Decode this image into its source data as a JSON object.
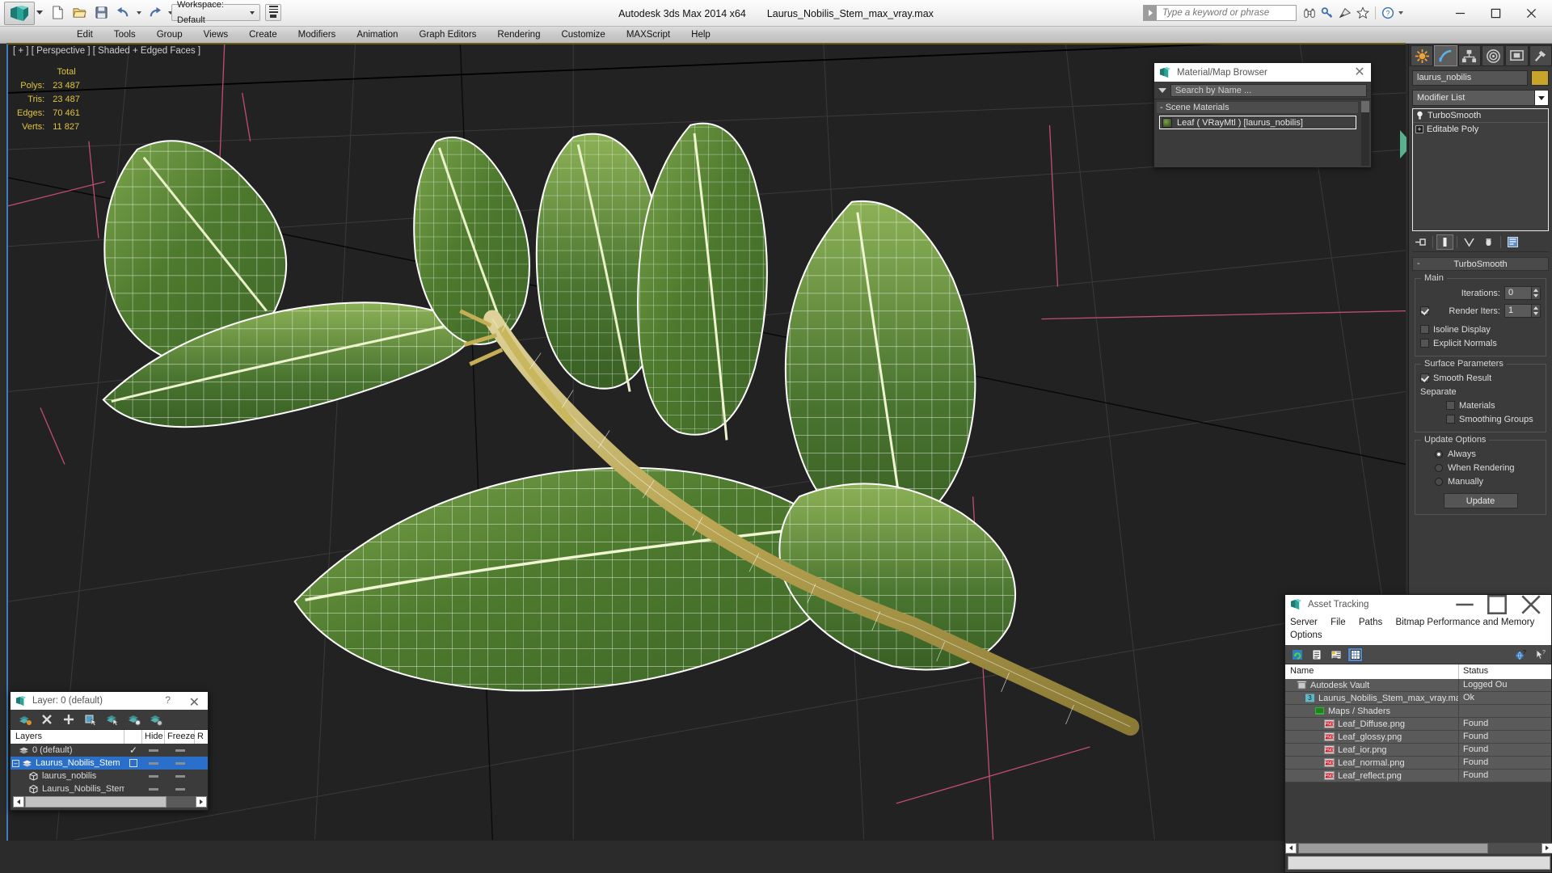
{
  "app": {
    "title_product": "Autodesk 3ds Max  2014 x64",
    "title_file": "Laurus_Nobilis_Stem_max_vray.max",
    "logo_icon": "3dsmax-logo-icon"
  },
  "quick_access": {
    "items": [
      {
        "name": "new-file-button",
        "icon": "new-file-icon"
      },
      {
        "name": "open-file-button",
        "icon": "open-folder-icon"
      },
      {
        "name": "save-file-button",
        "icon": "save-disk-icon"
      },
      {
        "name": "undo-button",
        "icon": "undo-arrow-icon"
      },
      {
        "name": "undo-dropdown",
        "icon": "chevron-down-icon"
      },
      {
        "name": "redo-button",
        "icon": "redo-arrow-icon"
      },
      {
        "name": "redo-dropdown",
        "icon": "chevron-down-icon"
      },
      {
        "name": "set-project-folder-button",
        "icon": "project-folder-icon"
      }
    ],
    "workspace_label": "Workspace: Default"
  },
  "search": {
    "placeholder": "Type a keyword or phrase",
    "value": ""
  },
  "title_icons": [
    {
      "name": "info-center-button",
      "icon": "binoculars-icon"
    },
    {
      "name": "subscription-center-button",
      "icon": "key-icon"
    },
    {
      "name": "communication-center-button",
      "icon": "satellite-dish-icon"
    },
    {
      "name": "favorites-button",
      "icon": "star-icon"
    },
    {
      "name": "help-button",
      "icon": "question-circle-icon"
    }
  ],
  "window_buttons": [
    {
      "name": "minimize-window-button",
      "icon": "minimize-icon"
    },
    {
      "name": "maximize-window-button",
      "icon": "maximize-icon"
    },
    {
      "name": "close-window-button",
      "icon": "close-icon"
    }
  ],
  "menubar": {
    "items": [
      "Edit",
      "Tools",
      "Group",
      "Views",
      "Create",
      "Modifiers",
      "Animation",
      "Graph Editors",
      "Rendering",
      "Customize",
      "MAXScript",
      "Help"
    ]
  },
  "viewport": {
    "label": "[ + ] [ Perspective ] [ Shaded + Edged Faces ]",
    "stats": {
      "header": "Total",
      "rows": [
        {
          "label": "Polys:",
          "value": "23 487"
        },
        {
          "label": "Tris:",
          "value": "23 487"
        },
        {
          "label": "Edges:",
          "value": "70 461"
        },
        {
          "label": "Verts:",
          "value": "11 827"
        }
      ]
    }
  },
  "material_browser": {
    "title": "Material/Map Browser",
    "close_label": "✕",
    "search_placeholder": "Search by Name ...",
    "group_label": "- Scene Materials",
    "items": [
      {
        "label": "Leaf  ( VRayMtl )  [laurus_nobilis]",
        "selected": true
      }
    ]
  },
  "command_panel": {
    "tabs": [
      {
        "name": "tab-create",
        "icon": "create-star-icon",
        "active": false
      },
      {
        "name": "tab-modify",
        "icon": "modify-curve-icon",
        "active": true
      },
      {
        "name": "tab-hierarchy",
        "icon": "hierarchy-icon",
        "active": false
      },
      {
        "name": "tab-motion",
        "icon": "motion-wheel-icon",
        "active": false
      },
      {
        "name": "tab-display",
        "icon": "display-monitor-icon",
        "active": false
      },
      {
        "name": "tab-utilities",
        "icon": "utilities-hammer-icon",
        "active": false
      }
    ],
    "object_name": "laurus_nobilis",
    "object_color": "#c8a42a",
    "modifier_list_label": "Modifier List",
    "stack": [
      {
        "label": "TurboSmooth",
        "icon": "lightbulb-icon",
        "selected": true
      },
      {
        "label": "Editable Poly",
        "icon": "expand-plus-icon",
        "selected": false
      }
    ],
    "stack_buttons": [
      {
        "name": "pin-stack-button",
        "icon": "pin-stack-icon"
      },
      {
        "name": "show-end-result-button",
        "icon": "show-end-result-icon"
      },
      {
        "name": "make-unique-button",
        "icon": "make-unique-icon"
      },
      {
        "name": "remove-modifier-button",
        "icon": "trash-can-icon"
      },
      {
        "name": "configure-modifier-sets-button",
        "icon": "configure-sets-icon"
      }
    ],
    "turbosmooth": {
      "rollup_title": "TurboSmooth",
      "main_group": "Main",
      "iterations_label": "Iterations:",
      "iterations_value": "0",
      "render_iters_label": "Render Iters:",
      "render_iters_value": "1",
      "render_iters_checked": true,
      "isoline_display_label": "Isoline Display",
      "isoline_display_checked": false,
      "explicit_normals_label": "Explicit Normals",
      "explicit_normals_checked": false,
      "surface_group": "Surface Parameters",
      "smooth_result_label": "Smooth Result",
      "smooth_result_checked": true,
      "separate_label": "Separate",
      "separate_materials_label": "Materials",
      "separate_materials_checked": false,
      "separate_smoothing_label": "Smoothing Groups",
      "separate_smoothing_checked": false,
      "update_group": "Update Options",
      "update_always_label": "Always",
      "update_when_rendering_label": "When Rendering",
      "update_manually_label": "Manually",
      "update_selected": "Always",
      "update_button_label": "Update"
    }
  },
  "asset_tracking": {
    "title": "Asset Tracking",
    "menu": [
      "Server",
      "File",
      "Paths",
      "Bitmap Performance and Memory",
      "Options"
    ],
    "toolbar": [
      {
        "name": "refresh-button",
        "icon": "refresh-icon",
        "active": false
      },
      {
        "name": "list-view-button",
        "icon": "list-icon",
        "active": false
      },
      {
        "name": "detail-view-button",
        "icon": "detail-icon",
        "active": false
      },
      {
        "name": "grid-view-button",
        "icon": "grid-icon",
        "active": true
      },
      {
        "name": "help-globe-button",
        "icon": "help-globe-icon",
        "active": false
      },
      {
        "name": "help-cursor-button",
        "icon": "help-cursor-icon",
        "active": false
      }
    ],
    "columns": [
      "Name",
      "Status"
    ],
    "rows": [
      {
        "name": "Autodesk Vault",
        "status": "Logged Ou",
        "indent": 0,
        "icon": "vault-icon"
      },
      {
        "name": "Laurus_Nobilis_Stem_max_vray.max",
        "status": "Ok",
        "indent": 1,
        "icon": "max-file-icon"
      },
      {
        "name": "Maps / Shaders",
        "status": "",
        "indent": 2,
        "icon": "maps-shaders-icon"
      },
      {
        "name": "Leaf_Diffuse.png",
        "status": "Found",
        "indent": 3,
        "icon": "png-icon"
      },
      {
        "name": "Leaf_glossy.png",
        "status": "Found",
        "indent": 3,
        "icon": "png-icon"
      },
      {
        "name": "Leaf_ior.png",
        "status": "Found",
        "indent": 3,
        "icon": "png-icon"
      },
      {
        "name": "Leaf_normal.png",
        "status": "Found",
        "indent": 3,
        "icon": "png-icon"
      },
      {
        "name": "Leaf_reflect.png",
        "status": "Found",
        "indent": 3,
        "icon": "png-icon"
      }
    ],
    "window_buttons": [
      {
        "name": "minimize-asset-button",
        "icon": "minimize-icon"
      },
      {
        "name": "maximize-asset-button",
        "icon": "maximize-icon"
      },
      {
        "name": "close-asset-button",
        "icon": "close-icon"
      }
    ]
  },
  "layer_dialog": {
    "title": "Layer: 0 (default)",
    "help_label": "?",
    "close_label": "✕",
    "toolbar": [
      {
        "name": "create-new-layer-button",
        "icon": "new-layer-icon"
      },
      {
        "name": "delete-layer-button",
        "icon": "delete-layer-icon"
      },
      {
        "name": "add-selection-to-layer-button",
        "icon": "add-layer-icon"
      },
      {
        "name": "select-objects-in-layer-button",
        "icon": "select-in-layer-icon"
      },
      {
        "name": "select-highlighted-layers-button",
        "icon": "select-highlighted-icon"
      },
      {
        "name": "highlight-selected-objects-layer-button",
        "icon": "highlight-selected-icon"
      },
      {
        "name": "layer-properties-button",
        "icon": "layer-properties-icon"
      }
    ],
    "columns": [
      "Layers",
      "",
      "Hide",
      "Freeze",
      "R"
    ],
    "rows": [
      {
        "name": "0 (default)",
        "indent": 1,
        "selected": false,
        "current": true,
        "icon": "layer-icon",
        "expandable": false
      },
      {
        "name": "Laurus_Nobilis_Stem",
        "indent": 0,
        "selected": true,
        "current": false,
        "icon": "layer-icon",
        "expandable": true
      },
      {
        "name": "laurus_nobilis",
        "indent": 2,
        "selected": false,
        "current": false,
        "icon": "object-icon",
        "expandable": false
      },
      {
        "name": "Laurus_Nobilis_Stem",
        "indent": 2,
        "selected": false,
        "current": false,
        "icon": "object-icon",
        "expandable": false
      }
    ]
  },
  "colors": {
    "viewport_bg": "#222222",
    "panel_bg": "#3b3b3b",
    "selection_blue": "#2a6fc9",
    "stat_yellow": "#e0c341",
    "leaf_green": "#5f8a3a",
    "stem_yellow": "#c8b05a",
    "wire_white": "#ffffff"
  }
}
